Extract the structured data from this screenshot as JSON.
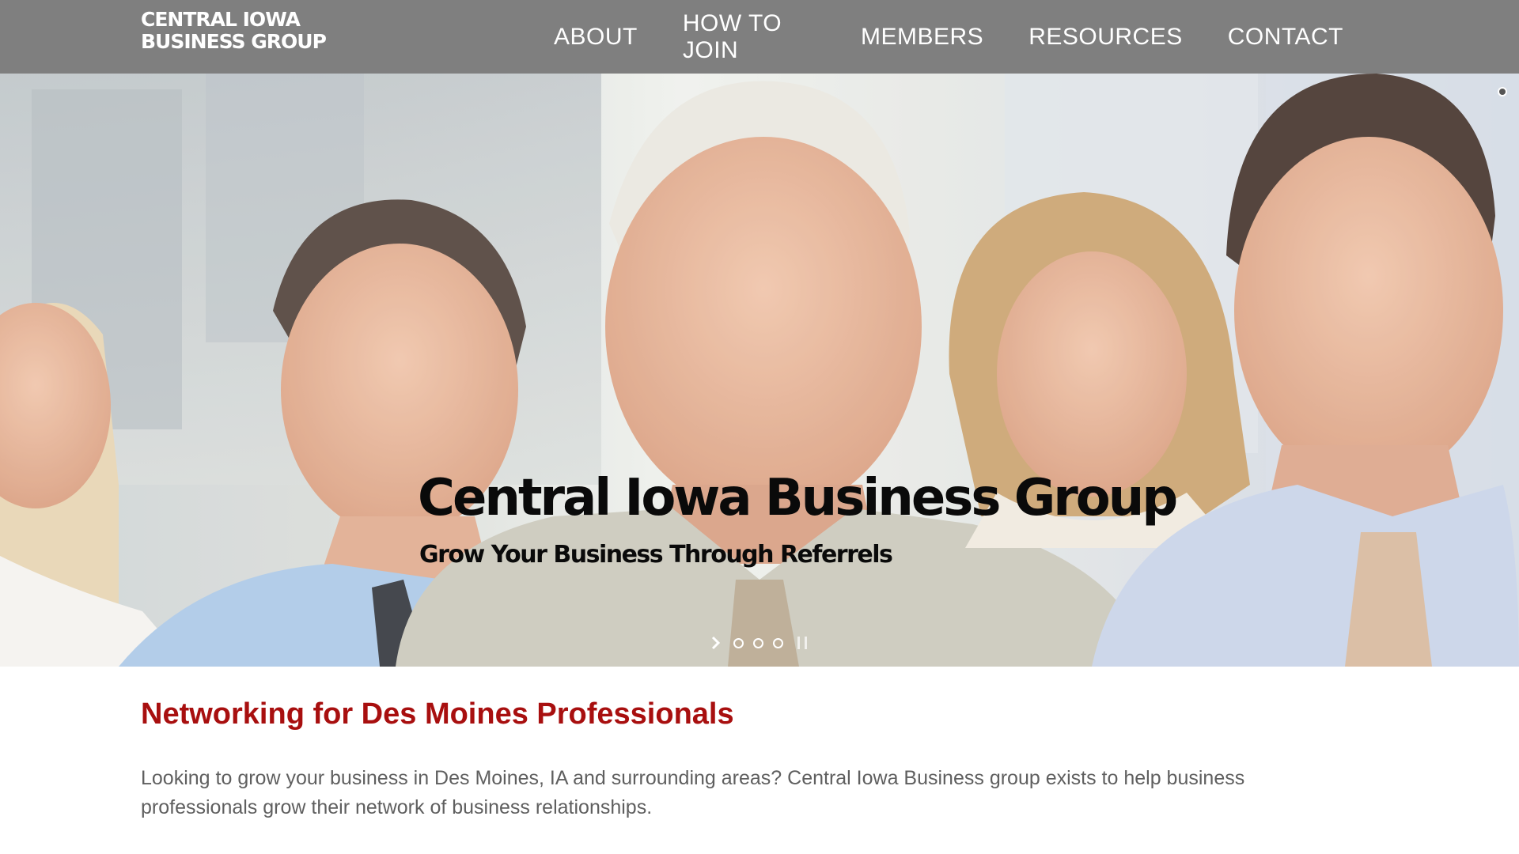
{
  "header": {
    "logo_line1": "CENTRAL IOWA",
    "logo_line2": "BUSINESS GROUP",
    "nav": [
      {
        "label": "ABOUT"
      },
      {
        "label": "HOW TO JOIN"
      },
      {
        "label": "MEMBERS"
      },
      {
        "label": "RESOURCES"
      },
      {
        "label": "CONTACT"
      }
    ]
  },
  "hero": {
    "title": "Central Iowa Business Group",
    "subtitle": "Grow Your Business Through Referrels",
    "slider": {
      "next_icon": "chevron-right-icon",
      "slide_count": 3,
      "pause_icon": "pause-icon"
    }
  },
  "content": {
    "title": "Networking for Des Moines Professionals",
    "body": "Looking to grow your business in Des Moines, IA and surrounding areas? Central Iowa Business group exists to help business professionals grow their network of business relationships."
  },
  "colors": {
    "header_bg": "#7f7f7f",
    "accent_red": "#a80f0f",
    "body_text": "#5f5f5f"
  }
}
